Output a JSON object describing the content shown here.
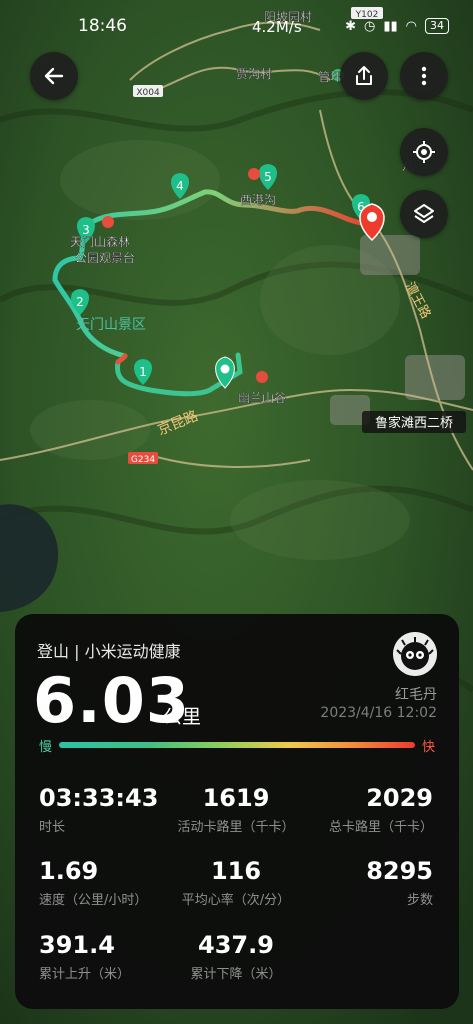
{
  "status_bar": {
    "time": "18:46",
    "network_speed": "4.2M/s",
    "battery": "34"
  },
  "map": {
    "labels": {
      "yangpo": "阳坡园村",
      "y102": "Y102",
      "jiagou": "贾沟村",
      "guanpo": "管坪",
      "x004": "X004",
      "xigang": "西港沟",
      "tianmen_forest_1": "天门山森林",
      "tianmen_forest_2": "公园观景台",
      "tianmen_area": "天门山景区",
      "youlan": "幽兰山谷",
      "jingkun": "京昆路",
      "g234": "G234",
      "lujiatan": "鲁家滩西二桥",
      "liwang": "澶王路",
      "ba": "八"
    },
    "markers": [
      "1",
      "2",
      "3",
      "4",
      "5",
      "6"
    ]
  },
  "card": {
    "title": "登山 | 小米运动健康",
    "distance": "6.03",
    "distance_unit": "公里",
    "user_name": "红毛丹",
    "date_time": "2023/4/16 12:02",
    "slow_label": "慢",
    "fast_label": "快",
    "stats": [
      {
        "value": "03:33:43",
        "label": "时长"
      },
      {
        "value": "1619",
        "label": "活动卡路里（千卡）"
      },
      {
        "value": "2029",
        "label": "总卡路里（千卡）"
      },
      {
        "value": "1.69",
        "label": "速度（公里/小时）"
      },
      {
        "value": "116",
        "label": "平均心率（次/分）"
      },
      {
        "value": "8295",
        "label": "步数"
      },
      {
        "value": "391.4",
        "label": "累计上升（米）"
      },
      {
        "value": "437.9",
        "label": "累计下降（米）"
      }
    ]
  },
  "colors": {
    "route_start": "#2fc7a5",
    "route_mid": "#a8d85a",
    "route_end": "#ef3b2c",
    "marker": "#1fbf8a",
    "card_bg": "#0c0c0c"
  }
}
